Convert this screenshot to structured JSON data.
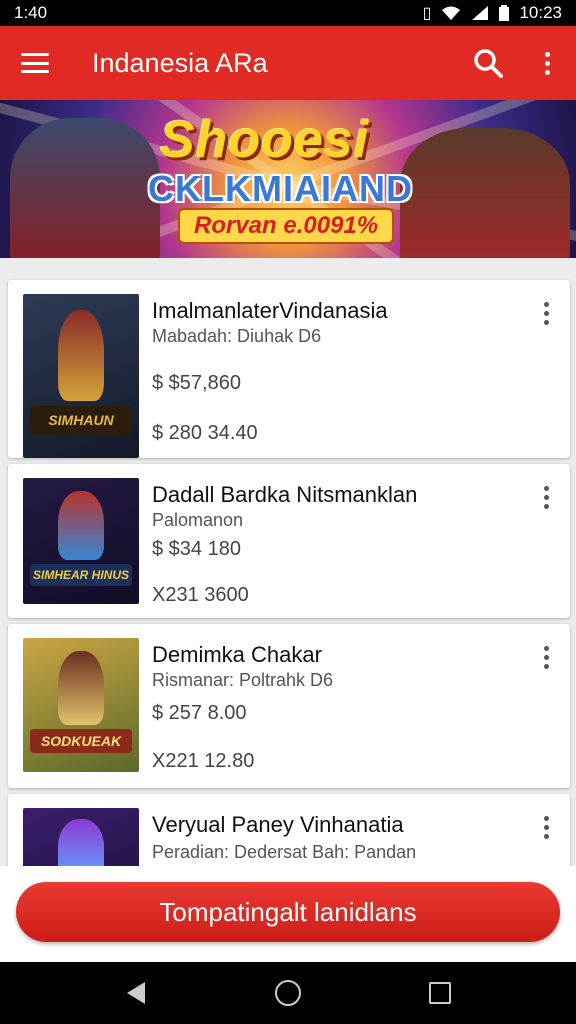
{
  "status_bar": {
    "time_left": "1:40",
    "time_right": "10:23",
    "icons": [
      "vibrate-icon",
      "wifi-icon",
      "signal-icon",
      "battery-icon"
    ]
  },
  "app_bar": {
    "title": "Indanesia ARa",
    "icons": [
      "menu-icon",
      "search-icon",
      "more-vert-icon"
    ]
  },
  "banner": {
    "title": "Shooesi",
    "subtitle": "CKLKMIAIAND",
    "promo": "Rorvan e.0091%"
  },
  "items": [
    {
      "title": "ImalmanlaterVindanasia",
      "subtitle": "Mabadah: Diuhak D6",
      "price1": "$ $57,860",
      "price2": "$ 280 34.40",
      "thumb_label": "SIMHAUN",
      "thumb_colors": [
        "#2e3b56",
        "#8a2a2a",
        "#d2a43a"
      ]
    },
    {
      "title": "Dadall Bardka Nitsmanklan",
      "subtitle": "Palomanon",
      "price1": "$ $34 180",
      "price2": "X231 3600",
      "thumb_label": "SIMHEAR HINUS",
      "thumb_colors": [
        "#241a45",
        "#b8332c",
        "#3a86d6"
      ]
    },
    {
      "title": "Demimka Chakar",
      "subtitle": "Rismanar: Poltrahk D6",
      "price1": "$ 257 8.00",
      "price2": "X221 12.80",
      "thumb_label": "SODKUEAK",
      "thumb_colors": [
        "#caa544",
        "#6a2f22",
        "#e2c36a"
      ]
    },
    {
      "title": "Veryual Paney Vinhanatia",
      "subtitle": "Peradian: Dedersat Bah: Pandan",
      "price1": "",
      "price2": "",
      "thumb_label": "",
      "thumb_colors": [
        "#3b1f6e",
        "#8a3ad6",
        "#5fa8ff"
      ]
    }
  ],
  "cta": {
    "label": "Tompatingalt lanidlans"
  },
  "nav_bar": {
    "icons": [
      "back-icon",
      "home-icon",
      "recents-icon"
    ]
  }
}
